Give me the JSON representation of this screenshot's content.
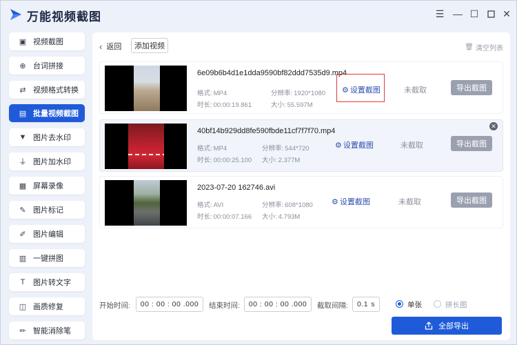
{
  "app": {
    "title": "万能视频截图",
    "window_controls": {
      "menu": "☰",
      "minimize": "—",
      "maximize": "☐",
      "close": "✕"
    }
  },
  "sidebar": {
    "items": [
      {
        "label": "视频截图",
        "icon": "image-icon",
        "glyph": "▣"
      },
      {
        "label": "台词拼接",
        "icon": "plus-circle-icon",
        "glyph": "⊕"
      },
      {
        "label": "视频格式转换",
        "icon": "convert-icon",
        "glyph": "⇄"
      },
      {
        "label": "批量视频截图",
        "icon": "batch-icon",
        "glyph": "▤",
        "active": true
      },
      {
        "label": "图片去水印",
        "icon": "brush-icon",
        "glyph": "▼"
      },
      {
        "label": "图片加水印",
        "icon": "stamp-icon",
        "glyph": "⏚"
      },
      {
        "label": "屏幕录像",
        "icon": "screen-record-icon",
        "glyph": "▦"
      },
      {
        "label": "图片标记",
        "icon": "mark-icon",
        "glyph": "✎"
      },
      {
        "label": "图片编辑",
        "icon": "edit-icon",
        "glyph": "✐"
      },
      {
        "label": "一键拼图",
        "icon": "collage-icon",
        "glyph": "▥"
      },
      {
        "label": "图片转文字",
        "icon": "text-icon",
        "glyph": "T"
      },
      {
        "label": "画质修复",
        "icon": "repair-icon",
        "glyph": "◫"
      },
      {
        "label": "智能消除笔",
        "icon": "eraser-icon",
        "glyph": "✏"
      }
    ]
  },
  "toolbar": {
    "back_label": "返回",
    "add_video_label": "添加视频",
    "clear_list_label": "清空列表"
  },
  "videos": [
    {
      "filename": "6e09b6b4d1e1dda9590bf82ddd7535d9.mp4",
      "format_label": "格式:",
      "format": "MP4",
      "resolution_label": "分辨率:",
      "resolution": "1920*1080",
      "duration_label": "时长:",
      "duration": "00:00:19.861",
      "size_label": "大小:",
      "size": "55.597M",
      "set_label": "设置截图",
      "status": "未截取",
      "export_label": "导出截图"
    },
    {
      "filename": "40bf14b929dd8fe590fbde11cf7f7f70.mp4",
      "format_label": "格式:",
      "format": "MP4",
      "resolution_label": "分辨率:",
      "resolution": "544*720",
      "duration_label": "时长:",
      "duration": "00:00:25.100",
      "size_label": "大小:",
      "size": "2.377M",
      "set_label": "设置截图",
      "status": "未截取",
      "export_label": "导出截图"
    },
    {
      "filename": "2023-07-20 162746.avi",
      "format_label": "格式:",
      "format": "AVI",
      "resolution_label": "分辨率:",
      "resolution": "608*1080",
      "duration_label": "时长:",
      "duration": "00:00:07.166",
      "size_label": "大小:",
      "size": "4.793M",
      "set_label": "设置截图",
      "status": "未截取",
      "export_label": "导出截图"
    }
  ],
  "bottom": {
    "start_label": "开始时间:",
    "start_value": "00 : 00 : 00 .000",
    "end_label": "结束时间:",
    "end_value": "00 : 00 : 00 .000",
    "interval_label": "截取间隔:",
    "interval_value": "0.1",
    "interval_unit": "s",
    "mode_single": "单张",
    "mode_long": "拼长图",
    "export_all_label": "全部导出"
  },
  "colors": {
    "accent": "#1f5bd9",
    "highlight_box": "#e23a3a",
    "disabled_button": "#9aa0b0"
  }
}
